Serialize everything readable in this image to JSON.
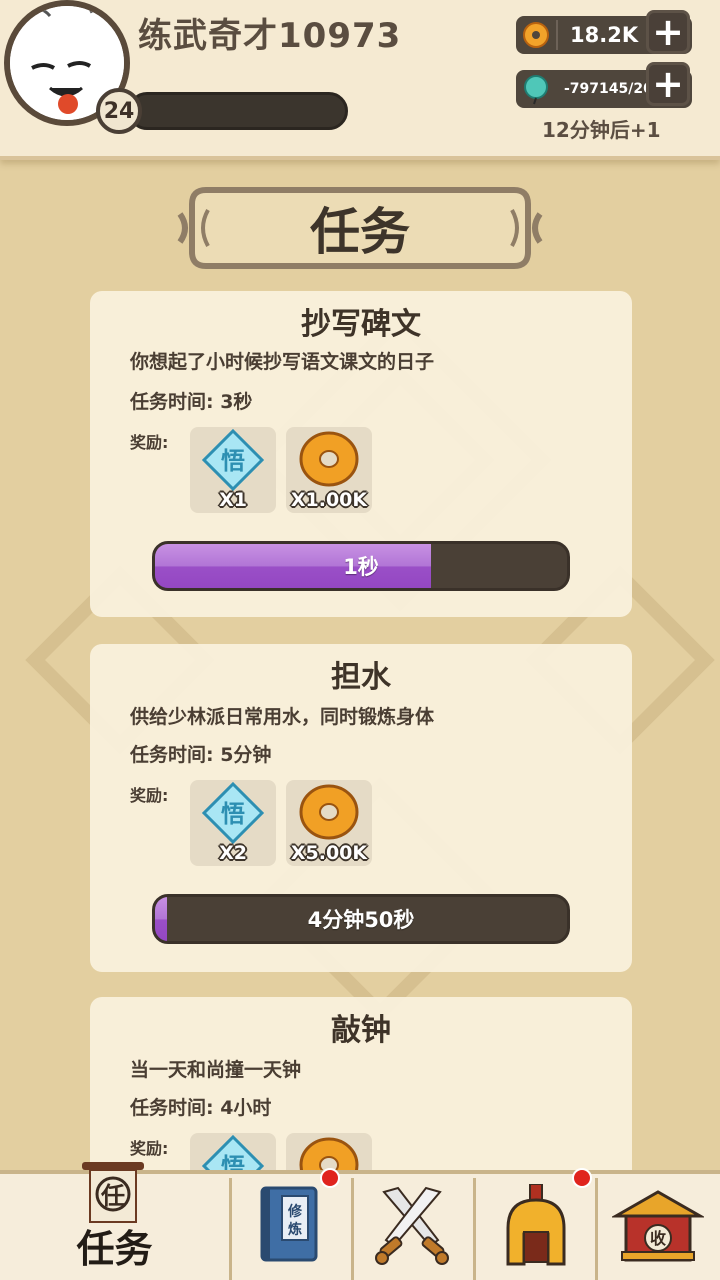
{
  "player": {
    "name": "练武奇才10973",
    "level": "24",
    "avatar_icon": "white-ghost-avatar-icon"
  },
  "resources": {
    "coins": {
      "icon": "coin-icon",
      "value": "18.2K"
    },
    "stamina": {
      "icon": "teal-gourd-icon",
      "value": "-797145/20"
    },
    "regen_text": "12分钟后+1"
  },
  "page_title": "任务",
  "tasks": [
    {
      "title": "抄写碑文",
      "desc": "你想起了小时候抄写语文课文的日子",
      "time": "任务时间: 3秒",
      "reward_label": "奖励:",
      "rewards": [
        {
          "icon": "insight-diamond-icon",
          "glyph": "悟",
          "qty": "X1"
        },
        {
          "icon": "copper-coin-icon",
          "qty": "X1.00K"
        }
      ],
      "progress": 0.67,
      "progress_text": "1秒"
    },
    {
      "title": "担水",
      "desc": "供给少林派日常用水，同时锻炼身体",
      "time": "任务时间: 5分钟",
      "reward_label": "奖励:",
      "rewards": [
        {
          "icon": "insight-diamond-icon",
          "glyph": "悟",
          "qty": "X2"
        },
        {
          "icon": "copper-coin-icon",
          "qty": "X5.00K"
        }
      ],
      "progress": 0.03,
      "progress_text": "4分钟50秒"
    },
    {
      "title": "敲钟",
      "desc": "当一天和尚撞一天钟",
      "time": "任务时间: 4小时",
      "reward_label": "奖励:",
      "rewards": [
        {
          "icon": "insight-diamond-icon",
          "glyph": "悟"
        },
        {
          "icon": "copper-coin-icon"
        }
      ]
    }
  ],
  "nav": [
    {
      "id": "tasks",
      "label": "任务",
      "icon_glyph": "任",
      "active": true
    },
    {
      "id": "training",
      "label": "",
      "icon_glyph": "修炼",
      "badge": true
    },
    {
      "id": "battle",
      "label": "",
      "icon": "crossed-swords-icon"
    },
    {
      "id": "equipment",
      "label": "",
      "icon": "helmet-icon",
      "badge": true
    },
    {
      "id": "collect",
      "label": "",
      "icon_glyph": "收"
    }
  ],
  "colors": {
    "background": "#e3cfa0",
    "header": "#f5ead2",
    "progress_fill": "#a45ccc",
    "badge_red": "#e0241e"
  }
}
